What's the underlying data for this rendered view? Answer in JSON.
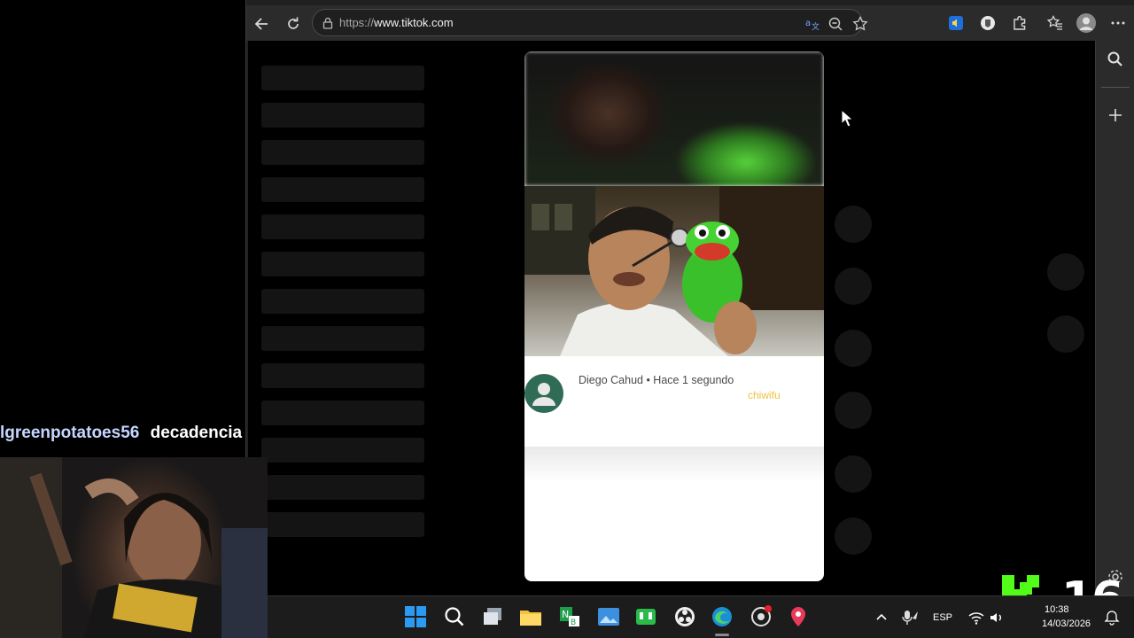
{
  "browser": {
    "url_prefix": "https://",
    "url_domain": "www.tiktok.com",
    "toolbar_icons": [
      "back-icon",
      "refresh-icon",
      "lock-icon",
      "translate-icon",
      "zoom-out-icon",
      "favorite-star-icon",
      "read-aloud-icon",
      "extension-icon",
      "puzzle-icon",
      "favorites-icon",
      "profile-icon",
      "more-icon"
    ],
    "sidebar_icons": [
      "search-icon",
      "add-icon",
      "settings-icon"
    ]
  },
  "tiktok": {
    "comment": {
      "author_line": "Diego Cahud • Hace 1 segundo",
      "text": "chiwifu"
    }
  },
  "stream": {
    "chat_user": "lgreenpotatoes56",
    "chat_message": "decadencia",
    "kick_counter": "16"
  },
  "taskbar": {
    "language": "ESP",
    "time": "10:38",
    "date": "14/03/2026",
    "apps": [
      "windows-start-icon",
      "search-icon",
      "task-view-icon",
      "file-explorer-icon",
      "notebook-app-icon",
      "photos-app-icon",
      "green-app-icon",
      "obs-icon",
      "edge-icon",
      "recorder-icon",
      "maps-pin-icon"
    ]
  }
}
